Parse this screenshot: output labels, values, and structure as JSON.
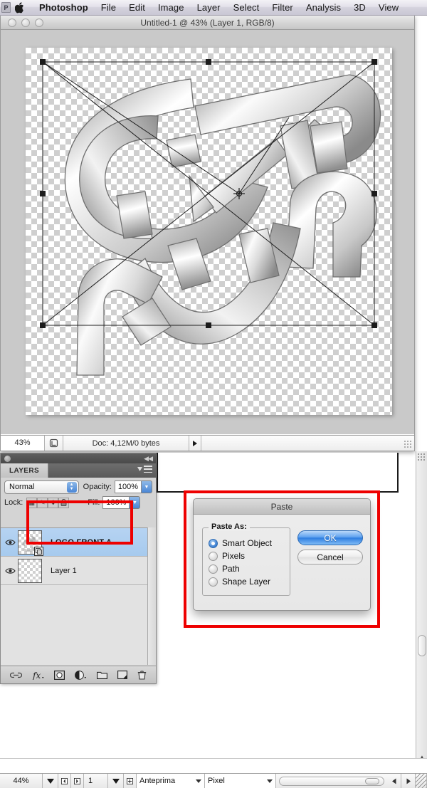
{
  "menubar": {
    "app_badge": "P",
    "apple_icon": "apple-logo-icon",
    "items": [
      {
        "label": "Photoshop",
        "bold": true
      },
      {
        "label": "File",
        "bold": false
      },
      {
        "label": "Edit",
        "bold": false
      },
      {
        "label": "Image",
        "bold": false
      },
      {
        "label": "Layer",
        "bold": false
      },
      {
        "label": "Select",
        "bold": false
      },
      {
        "label": "Filter",
        "bold": false
      },
      {
        "label": "Analysis",
        "bold": false
      },
      {
        "label": "3D",
        "bold": false
      },
      {
        "label": "View",
        "bold": false
      }
    ]
  },
  "document_window": {
    "title": "Untitled-1 @ 43% (Layer 1, RGB/8)",
    "traffic_lights": [
      "close-button",
      "minimize-button",
      "zoom-button"
    ],
    "status_bar": {
      "zoom": "43%",
      "doc_info": "Doc: 4,12M/0 bytes",
      "preview_icon": "doc-preview-icon",
      "expand_arrow": "▶"
    }
  },
  "layers_panel": {
    "tab_label": "LAYERS",
    "menu_icon": "panel-menu-icon",
    "collapse_icon": "collapse-icon",
    "blend_mode": "Normal",
    "opacity_label": "Opacity:",
    "opacity_value": "100%",
    "lock_label": "Lock:",
    "lock_buttons": [
      {
        "name": "lock-transparent-pixels",
        "glyph": "▦"
      },
      {
        "name": "lock-image-pixels",
        "glyph": "✎"
      },
      {
        "name": "lock-position",
        "glyph": "✥"
      },
      {
        "name": "lock-all",
        "glyph": "🔒"
      }
    ],
    "fill_label": "Fill:",
    "fill_value": "100%",
    "layers": [
      {
        "name": "LOGO FRONT A",
        "selected": true,
        "visible": true,
        "smart_object": true
      },
      {
        "name": "Layer 1",
        "selected": false,
        "visible": true,
        "smart_object": false
      }
    ],
    "footer_buttons": [
      {
        "name": "link-layers-button",
        "glyph": "⛓"
      },
      {
        "name": "layer-style-button",
        "glyph": "fx"
      },
      {
        "name": "layer-mask-button",
        "glyph": "◙"
      },
      {
        "name": "adjustment-layer-button",
        "glyph": "◑"
      },
      {
        "name": "new-group-button",
        "glyph": "▭"
      },
      {
        "name": "new-layer-button",
        "glyph": "▣"
      },
      {
        "name": "delete-layer-button",
        "glyph": "🗑"
      }
    ]
  },
  "paste_dialog": {
    "title": "Paste",
    "fieldset_legend": "Paste As:",
    "options": [
      {
        "label": "Smart Object",
        "selected": true
      },
      {
        "label": "Pixels",
        "selected": false
      },
      {
        "label": "Path",
        "selected": false
      },
      {
        "label": "Shape Layer",
        "selected": false
      }
    ],
    "ok_label": "OK",
    "cancel_label": "Cancel"
  },
  "bottom_toolbar": {
    "zoom": "44%",
    "page_number": "1",
    "view_mode": "Anteprima",
    "units": "Pixel",
    "prev_page_icon": "prev-page-icon",
    "next_page_icon": "next-page-icon",
    "add_icon": "add-icon"
  },
  "annotations": {
    "highlight_color": "#ee0000",
    "boxes": [
      "layer-row-highlight",
      "paste-dialog-highlight"
    ]
  },
  "colors": {
    "selection_blue": "#a6caee",
    "primary_button": "#2f7ee0",
    "canvas_bg": "#c9c9c9",
    "panel_bg": "#d4d4d4"
  }
}
